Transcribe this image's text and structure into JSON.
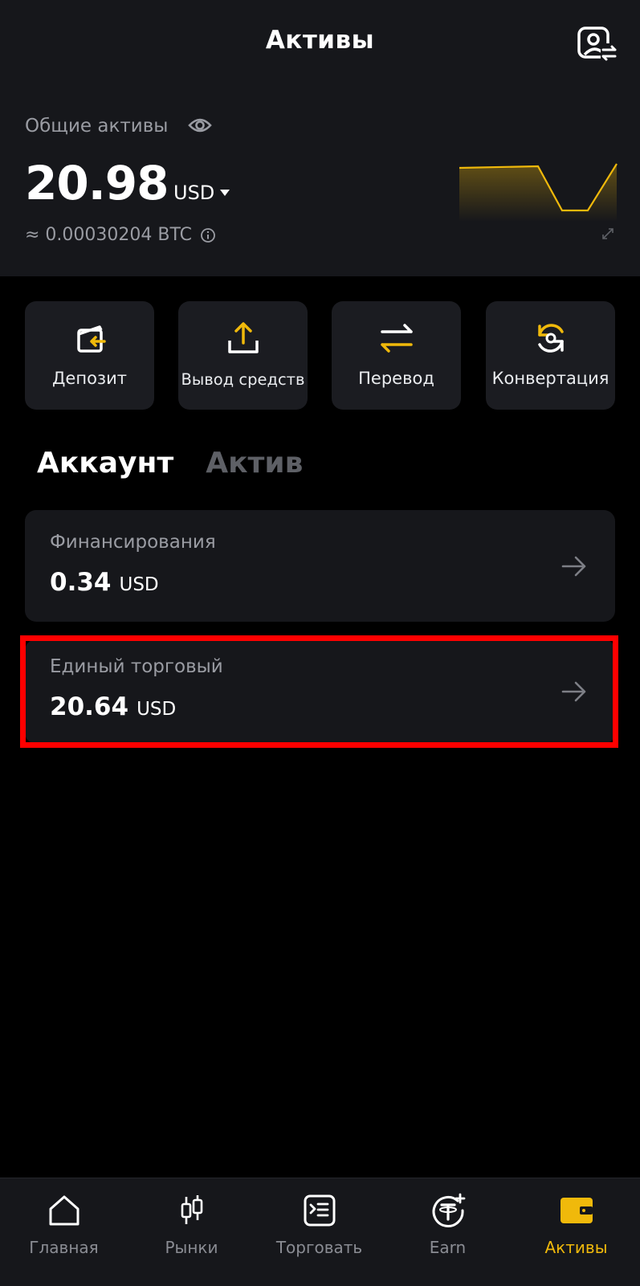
{
  "header": {
    "title": "Активы",
    "total_label": "Общие активы",
    "total_value": "20.98",
    "currency": "USD",
    "btc_equivalent": "≈ 0.00030204 BTC",
    "icons": [
      "profile-switch-icon",
      "eye-icon",
      "info-icon",
      "expand-icon"
    ]
  },
  "actions": [
    {
      "label": "Депозит",
      "icon": "deposit-icon"
    },
    {
      "label": "Вывод средств",
      "icon": "withdraw-icon"
    },
    {
      "label": "Перевод",
      "icon": "transfer-icon"
    },
    {
      "label": "Конвертация",
      "icon": "convert-icon"
    }
  ],
  "tabs": [
    {
      "label": "Аккаунт",
      "active": true
    },
    {
      "label": "Актив",
      "active": false
    }
  ],
  "accounts": [
    {
      "name": "Финансирования",
      "amount": "0.34",
      "currency": "USD"
    },
    {
      "name": "Единый торговый",
      "amount": "20.64",
      "currency": "USD",
      "highlighted": true
    }
  ],
  "bottom_nav": [
    {
      "label": "Главная",
      "icon": "home-icon",
      "active": false
    },
    {
      "label": "Рынки",
      "icon": "markets-icon",
      "active": false
    },
    {
      "label": "Торговать",
      "icon": "trade-icon",
      "active": false
    },
    {
      "label": "Earn",
      "icon": "earn-icon",
      "active": false
    },
    {
      "label": "Активы",
      "icon": "wallet-icon",
      "active": true
    }
  ],
  "colors": {
    "accent": "#f0b90b",
    "background": "#000000",
    "surface": "#16171b",
    "highlight_border": "#ff0000",
    "muted_text": "#9a9ca3"
  }
}
